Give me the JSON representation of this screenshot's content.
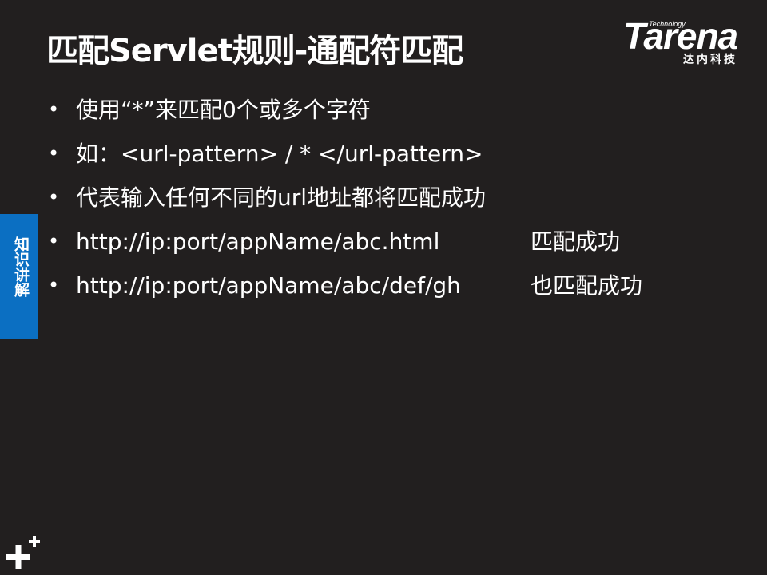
{
  "slide": {
    "title": "匹配Servlet规则-通配符匹配",
    "logo": {
      "brand": "Tarena",
      "technology": "Technology",
      "chinese": "达内科技"
    },
    "side_tab": "知识讲解",
    "bullets": [
      {
        "text": "使用“*”来匹配0个或多个字符",
        "suffix": ""
      },
      {
        "text": "如：<url-pattern> / * </url-pattern>",
        "suffix": ""
      },
      {
        "text": "代表输入任何不同的url地址都将匹配成功",
        "suffix": ""
      },
      {
        "text": "http://ip:port/appName/abc.html",
        "suffix": "匹配成功"
      },
      {
        "text": "http://ip:port/appName/abc/def/gh",
        "suffix": "也匹配成功"
      }
    ],
    "bullet_marker": "•",
    "colors": {
      "background": "#221f1f",
      "side_tab": "#0b6fc2",
      "text": "#ffffff"
    },
    "icons": {
      "corner": "plus-icon"
    }
  }
}
